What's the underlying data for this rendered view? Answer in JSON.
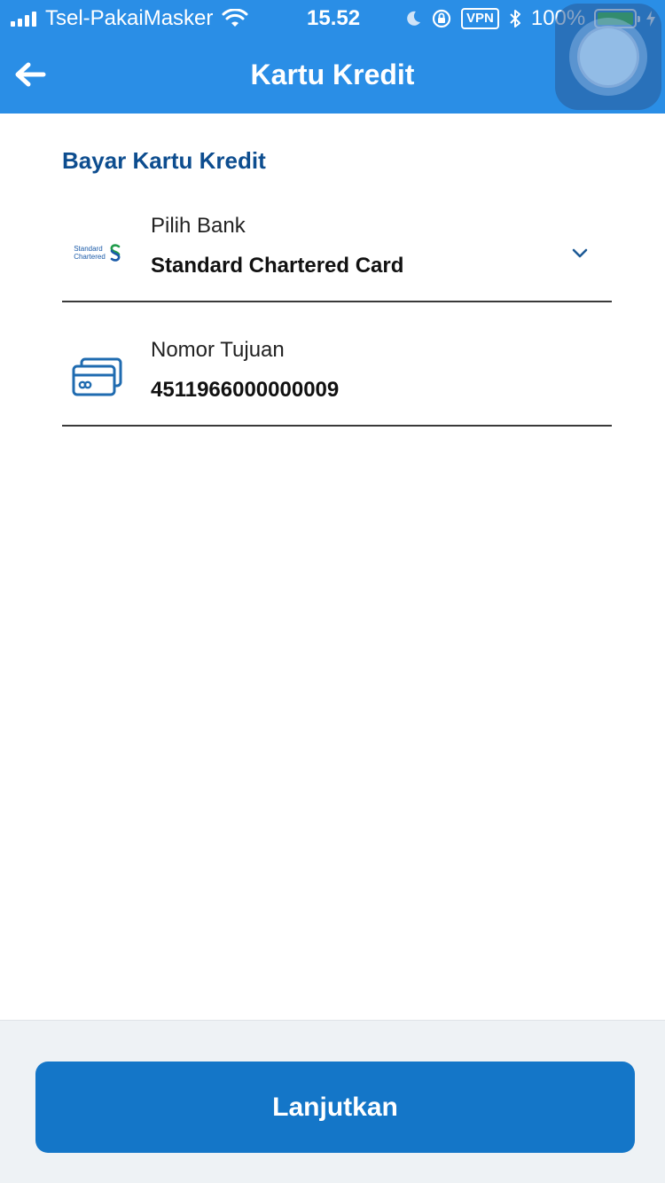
{
  "status_bar": {
    "carrier": "Tsel-PakaiMasker",
    "time": "15.52",
    "vpn": "VPN",
    "battery": "100%",
    "battery_level": 1.0
  },
  "app_bar": {
    "title": "Kartu Kredit",
    "back_icon": "arrow-left-icon"
  },
  "form": {
    "section_title": "Bayar Kartu Kredit",
    "bank": {
      "label": "Pilih Bank",
      "value": "Standard Chartered Card",
      "logo_text_line1": "Standard",
      "logo_text_line2": "Chartered",
      "icon": "standard-chartered-logo"
    },
    "destination": {
      "label": "Nomor Tujuan",
      "value": "4511966000000009",
      "icon": "credit-card-icon"
    }
  },
  "footer": {
    "continue_label": "Lanjutkan"
  },
  "colors": {
    "header": "#2a8ee6",
    "section_title": "#0d4d8f",
    "button": "#1476c8",
    "footer_bg": "#eef2f5"
  }
}
